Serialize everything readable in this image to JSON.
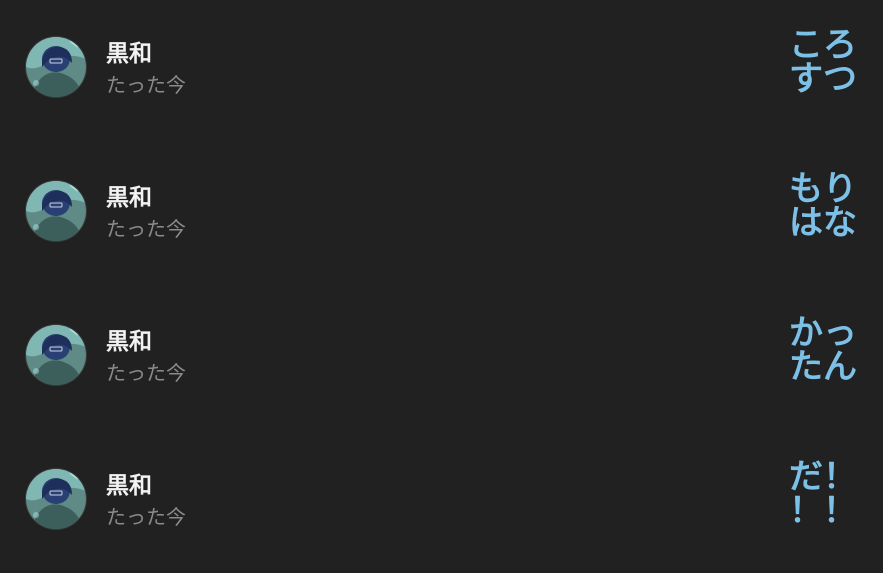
{
  "colors": {
    "background": "#212121",
    "username": "#f2f2f2",
    "timestamp": "#8a8a8a",
    "message": "#7cc0e8"
  },
  "posts": [
    {
      "author": "黒和",
      "time": "たった今",
      "message": [
        "ころ",
        "すつ"
      ]
    },
    {
      "author": "黒和",
      "time": "たった今",
      "message": [
        "もり",
        "はな"
      ]
    },
    {
      "author": "黒和",
      "time": "たった今",
      "message": [
        "かっ",
        "たん"
      ]
    },
    {
      "author": "黒和",
      "time": "たった今",
      "message": [
        "だ！",
        "！！"
      ]
    }
  ]
}
